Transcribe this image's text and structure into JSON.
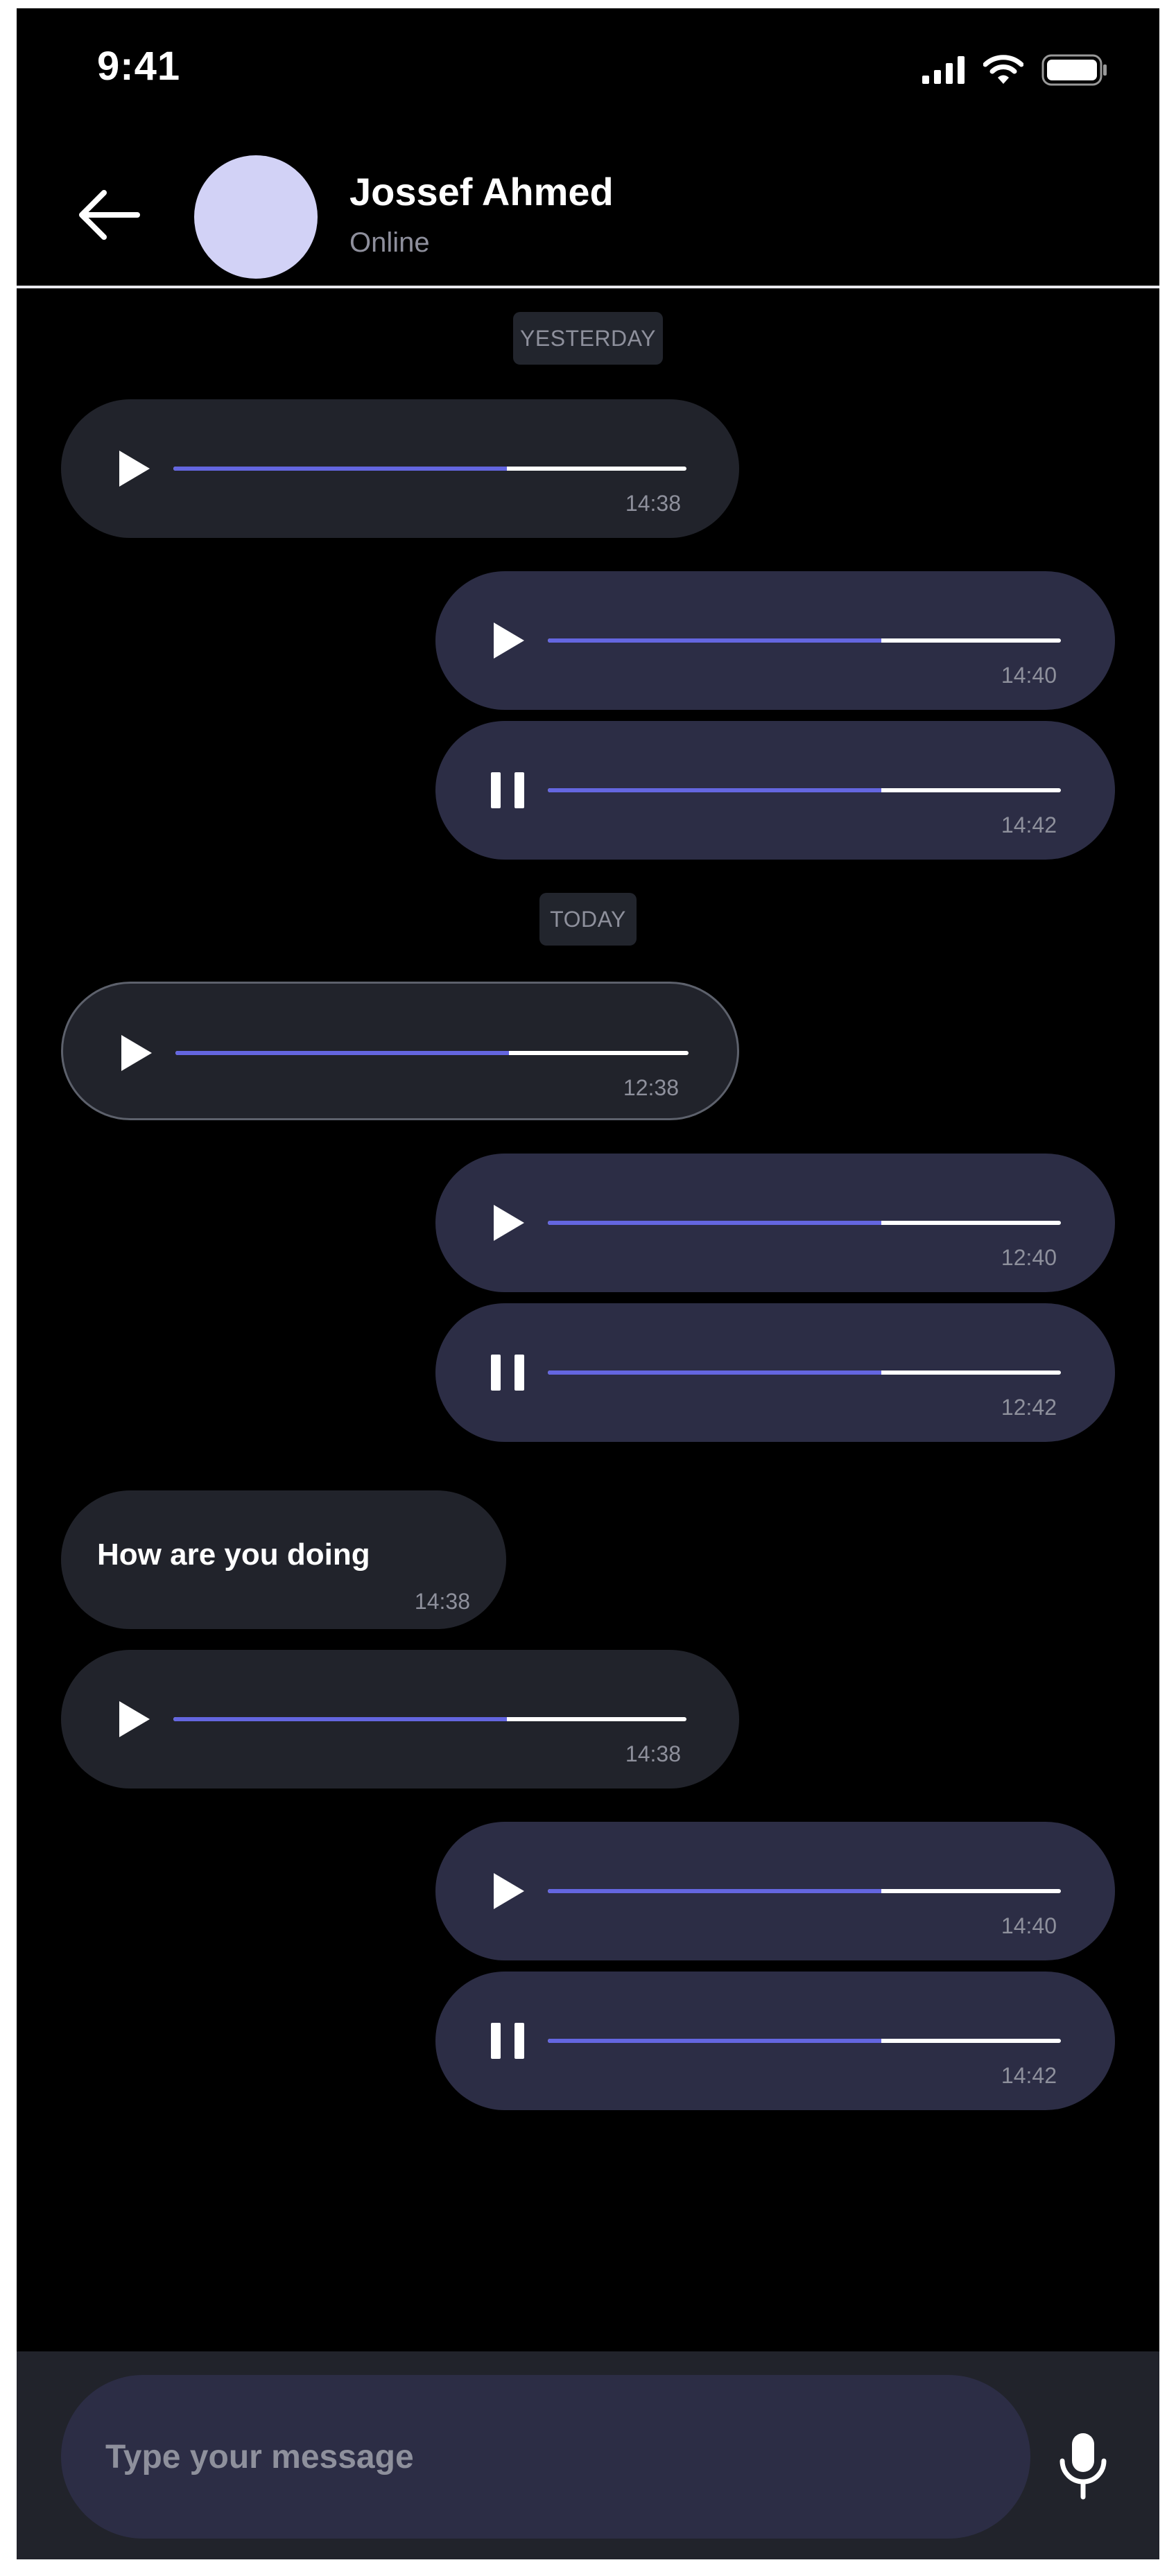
{
  "status_bar": {
    "time": "9:41",
    "icons": [
      "cellular-signal-icon",
      "wifi-icon",
      "battery-icon"
    ]
  },
  "header": {
    "back_icon": "arrow-left-icon",
    "contact_name": "Jossef Ahmed",
    "contact_status": "Online",
    "avatar_color": "#d2d2f6"
  },
  "colors": {
    "background": "#000000",
    "incoming_bubble": "#21232b",
    "outgoing_bubble": "#2c2d45",
    "progress_played": "#6466e0",
    "progress_remaining": "#ffffff",
    "muted_text": "#8e909c"
  },
  "chat": {
    "day_labels": {
      "yesterday": "YESTERDAY",
      "today": "TODAY"
    },
    "messages": [
      {
        "type": "voice",
        "direction": "incoming",
        "state": "play",
        "progress": 0.65,
        "time": "14:38"
      },
      {
        "type": "voice",
        "direction": "outgoing",
        "state": "play",
        "progress": 0.65,
        "time": "14:40"
      },
      {
        "type": "voice",
        "direction": "outgoing",
        "state": "pause",
        "progress": 0.65,
        "time": "14:42"
      },
      {
        "type": "voice",
        "direction": "incoming",
        "state": "play",
        "progress": 0.65,
        "time": "12:38",
        "selected": true
      },
      {
        "type": "voice",
        "direction": "outgoing",
        "state": "play",
        "progress": 0.65,
        "time": "12:40"
      },
      {
        "type": "voice",
        "direction": "outgoing",
        "state": "pause",
        "progress": 0.65,
        "time": "12:42"
      },
      {
        "type": "text",
        "direction": "incoming",
        "text": "How are you doing",
        "time": "14:38"
      },
      {
        "type": "voice",
        "direction": "incoming",
        "state": "play",
        "progress": 0.65,
        "time": "14:38"
      },
      {
        "type": "voice",
        "direction": "outgoing",
        "state": "play",
        "progress": 0.65,
        "time": "14:40"
      },
      {
        "type": "voice",
        "direction": "outgoing",
        "state": "pause",
        "progress": 0.65,
        "time": "14:42"
      }
    ]
  },
  "composer": {
    "placeholder": "Type your message",
    "value": "",
    "mic_icon": "microphone-icon"
  }
}
